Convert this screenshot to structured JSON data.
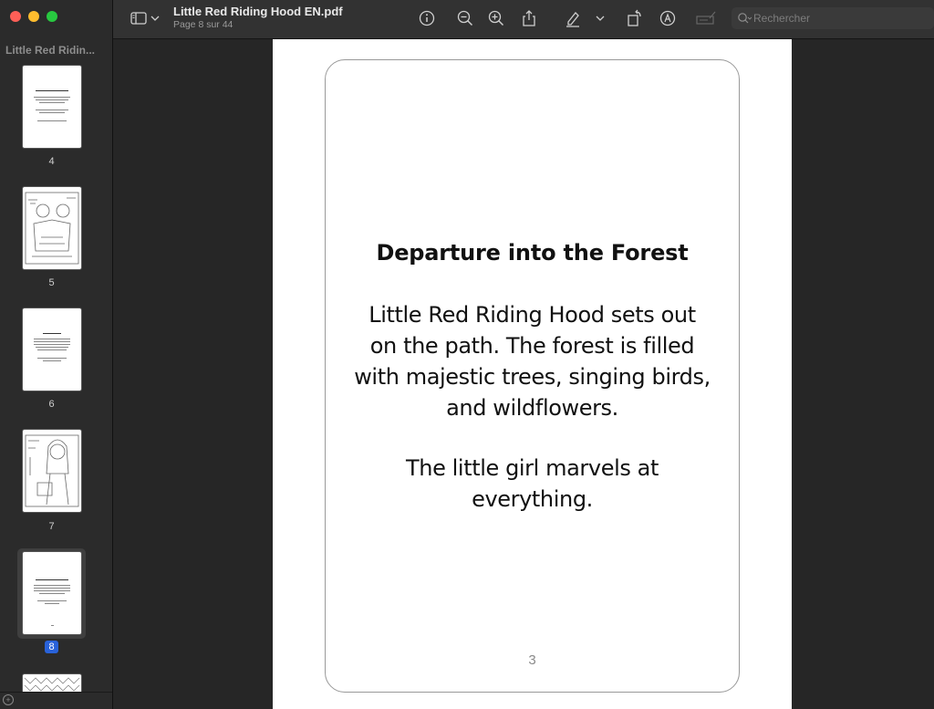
{
  "window": {
    "sidebar_title": "Little Red Ridin...",
    "doc_title": "Little Red Riding Hood EN.pdf",
    "doc_subtitle": "Page 8 sur 44"
  },
  "search": {
    "placeholder": "Rechercher"
  },
  "thumbnails": [
    {
      "label": "4",
      "kind": "text"
    },
    {
      "label": "5",
      "kind": "illustration"
    },
    {
      "label": "6",
      "kind": "text"
    },
    {
      "label": "7",
      "kind": "illustration"
    },
    {
      "label": "8",
      "kind": "text",
      "selected": true
    }
  ],
  "page": {
    "heading": "Departure into the Forest",
    "paragraph_1_lines": [
      "Little Red Riding Hood sets out",
      "on the path. The forest is filled",
      "with majestic trees, singing birds,",
      "and wildflowers."
    ],
    "paragraph_2_lines": [
      "The little girl marvels at",
      "everything."
    ],
    "page_number": "3"
  }
}
